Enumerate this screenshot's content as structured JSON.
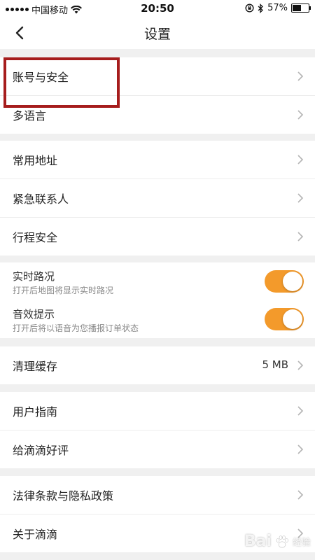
{
  "status_bar": {
    "carrier": "中国移动",
    "time": "20:50",
    "battery_percent": "57%",
    "battery_level": 0.57
  },
  "nav": {
    "title": "设置"
  },
  "groups": [
    [
      {
        "label": "账号与安全"
      },
      {
        "label": "多语言"
      }
    ],
    [
      {
        "label": "常用地址"
      },
      {
        "label": "紧急联系人"
      },
      {
        "label": "行程安全"
      }
    ],
    [
      {
        "label": "清理缓存",
        "value": "5 MB"
      }
    ],
    [
      {
        "label": "用户指南"
      },
      {
        "label": "给滴滴好评"
      }
    ],
    [
      {
        "label": "法律条款与隐私政策"
      },
      {
        "label": "关于滴滴"
      }
    ]
  ],
  "toggles": [
    {
      "title": "实时路况",
      "subtitle": "打开后地图将显示实时路况",
      "on": true
    },
    {
      "title": "音效提示",
      "subtitle": "打开后将以语音为您播报订单状态",
      "on": true
    }
  ],
  "watermark": {
    "brand": "Bai",
    "brand2": "经验"
  },
  "colors": {
    "toggle_on": "#f39a2b",
    "highlight": "#a61d1d",
    "background": "#f0f0f0"
  }
}
